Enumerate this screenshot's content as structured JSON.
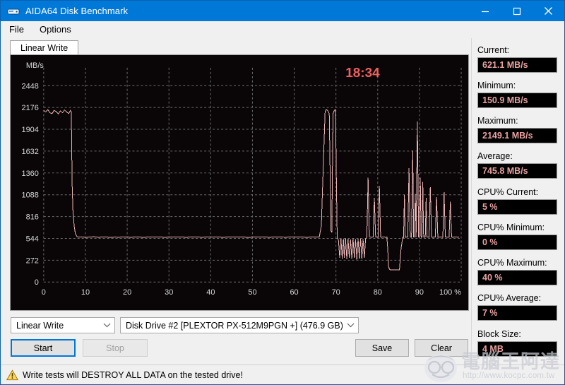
{
  "window": {
    "title": "AIDA64 Disk Benchmark",
    "icon": "disk-icon",
    "minimize_label": "–",
    "maximize_label": "□",
    "close_label": "✕"
  },
  "menu": {
    "items": [
      {
        "label": "File",
        "name": "menu-file"
      },
      {
        "label": "Options",
        "name": "menu-options"
      }
    ]
  },
  "tabs": [
    {
      "label": "Linear Write",
      "active": true
    }
  ],
  "chart_data": {
    "type": "line",
    "title": "",
    "timer": "18:34",
    "xlabel": "",
    "ylabel": "MB/s",
    "x_unit": "%",
    "xlim": [
      0,
      100
    ],
    "ylim": [
      0,
      2584
    ],
    "xticks": [
      0,
      10,
      20,
      30,
      40,
      50,
      60,
      70,
      80,
      90,
      100
    ],
    "xticklabels": [
      "0",
      "10",
      "20",
      "30",
      "40",
      "50",
      "60",
      "70",
      "80",
      "90",
      "100 %"
    ],
    "yticks": [
      0,
      272,
      544,
      816,
      1088,
      1360,
      1632,
      1904,
      2176,
      2448
    ],
    "yticklabels": [
      "0",
      "272",
      "544",
      "816",
      "1088",
      "1360",
      "1632",
      "1904",
      "2176",
      "2448"
    ],
    "grid": true,
    "grid_style": "dashed",
    "line_color": "#e9b4b4",
    "background": "#0a0608",
    "legend": null,
    "series": [
      {
        "name": "Linear Write",
        "x": [
          0.0,
          0.5,
          1.0,
          1.5,
          2.0,
          2.5,
          3.0,
          3.5,
          4.0,
          4.5,
          5.0,
          5.5,
          6.0,
          6.4,
          6.6,
          6.7,
          6.8,
          7.0,
          7.3,
          7.6,
          8.0,
          8.5,
          9.0,
          10.0,
          11.0,
          12.0,
          13.0,
          14.0,
          15.0,
          16.0,
          17.0,
          18.0,
          19.0,
          20.0,
          21.0,
          22.0,
          23.0,
          24.0,
          25.0,
          26.0,
          27.0,
          28.0,
          29.0,
          30.0,
          31.0,
          32.0,
          33.0,
          34.0,
          35.0,
          36.0,
          37.0,
          38.0,
          39.0,
          40.0,
          41.0,
          42.0,
          43.0,
          44.0,
          45.0,
          46.0,
          47.0,
          48.0,
          49.0,
          50.0,
          51.0,
          52.0,
          53.0,
          54.0,
          55.0,
          56.0,
          57.0,
          58.0,
          59.0,
          60.0,
          61.0,
          62.0,
          63.0,
          64.0,
          65.0,
          66.0,
          66.5,
          67.0,
          67.4,
          67.6,
          68.0,
          68.4,
          68.8,
          69.0,
          69.3,
          69.6,
          69.9,
          70.1,
          70.3,
          70.6,
          70.9,
          71.2,
          71.5,
          71.8,
          72.0,
          72.3,
          72.6,
          72.9,
          73.2,
          73.5,
          73.8,
          74.1,
          74.4,
          74.7,
          75.0,
          75.3,
          75.6,
          75.9,
          76.2,
          76.5,
          76.8,
          77.1,
          77.4,
          77.7,
          78.0,
          78.3,
          78.6,
          78.9,
          79.2,
          79.5,
          79.8,
          80.1,
          80.4,
          80.7,
          81.0,
          81.3,
          81.6,
          81.9,
          82.2,
          82.4,
          82.6,
          82.8,
          83.0,
          83.3,
          83.6,
          84.0,
          84.4,
          84.8,
          85.2,
          85.6,
          86.0,
          86.2,
          86.4,
          86.6,
          86.9,
          87.2,
          87.5,
          87.8,
          88.1,
          88.4,
          88.6,
          88.8,
          89.0,
          89.2,
          89.5,
          89.8,
          90.0,
          90.2,
          90.4,
          90.6,
          90.8,
          91.0,
          91.2,
          91.4,
          91.6,
          91.8,
          92.0,
          92.3,
          92.6,
          92.9,
          93.2,
          93.5,
          93.8,
          94.1,
          94.4,
          94.7,
          95.0,
          95.3,
          95.6,
          95.9,
          96.2,
          96.5,
          96.8,
          97.1,
          97.4,
          97.7,
          98.0,
          98.3,
          98.6,
          98.9,
          99.2,
          99.5,
          99.8,
          100.0
        ],
        "y": [
          2140,
          2120,
          2149,
          2110,
          2100,
          2140,
          2125,
          2095,
          2135,
          2110,
          2145,
          2120,
          2100,
          2140,
          2120,
          1780,
          1250,
          900,
          700,
          600,
          565,
          560,
          562,
          558,
          560,
          565,
          558,
          560,
          562,
          555,
          560,
          558,
          563,
          560,
          558,
          562,
          560,
          557,
          561,
          559,
          563,
          560,
          558,
          560,
          562,
          559,
          561,
          558,
          560,
          563,
          560,
          558,
          561,
          559,
          562,
          560,
          558,
          560,
          561,
          559,
          562,
          560,
          557,
          560,
          562,
          559,
          561,
          558,
          560,
          562,
          560,
          558,
          561,
          559,
          562,
          560,
          558,
          560,
          562,
          560,
          700,
          1500,
          2120,
          2149,
          2140,
          2100,
          640,
          620,
          2100,
          2140,
          2149,
          1300,
          560,
          520,
          300,
          540,
          290,
          535,
          300,
          545,
          285,
          540,
          300,
          530,
          290,
          545,
          300,
          535,
          280,
          540,
          295,
          545,
          290,
          535,
          300,
          540,
          560,
          1300,
          565,
          560,
          558,
          562,
          1050,
          560,
          562,
          558,
          1200,
          560,
          558,
          562,
          560,
          558,
          560,
          420,
          200,
          160,
          152,
          151,
          150,
          151,
          150,
          152,
          150,
          420,
          560,
          555,
          1090,
          558,
          562,
          560,
          1420,
          560,
          558,
          1640,
          562,
          560,
          1100,
          558,
          2000,
          560,
          562,
          1300,
          558,
          560,
          1250,
          562,
          558,
          560,
          1050,
          560,
          562,
          558,
          1180,
          560,
          558,
          562,
          560,
          1060,
          558,
          560,
          562,
          560,
          558,
          1120,
          560,
          562,
          558,
          560,
          1000,
          562,
          558,
          560,
          562,
          560,
          558,
          560
        ]
      }
    ]
  },
  "mode_select": {
    "value": "Linear Write",
    "name": "mode-select"
  },
  "drive_select": {
    "value": "Disk Drive #2  [PLEXTOR PX-512M9PGN +]  (476.9 GB)",
    "name": "drive-select"
  },
  "buttons": {
    "start": "Start",
    "stop": "Stop",
    "save": "Save",
    "clear": "Clear"
  },
  "stats": [
    {
      "label": "Current:",
      "value": "621.1 MB/s",
      "name": "current"
    },
    {
      "label": "Minimum:",
      "value": "150.9 MB/s",
      "name": "minimum"
    },
    {
      "label": "Maximum:",
      "value": "2149.1 MB/s",
      "name": "maximum"
    },
    {
      "label": "Average:",
      "value": "745.8 MB/s",
      "name": "average"
    }
  ],
  "cpu_stats": [
    {
      "label": "CPU% Current:",
      "value": "5 %",
      "name": "cpu-current"
    },
    {
      "label": "CPU% Minimum:",
      "value": "0 %",
      "name": "cpu-minimum"
    },
    {
      "label": "CPU% Maximum:",
      "value": "40 %",
      "name": "cpu-maximum"
    },
    {
      "label": "CPU% Average:",
      "value": "7 %",
      "name": "cpu-average"
    }
  ],
  "block_size": {
    "label": "Block Size:",
    "value": "4 MB"
  },
  "statusbar": {
    "icon": "warning-icon",
    "text": "Write tests will DESTROY ALL DATA on the tested drive!"
  },
  "watermark": {
    "brand": "電腦王阿達",
    "url": "http://www.kocpc.com.tw"
  },
  "colors": {
    "titlebar": "#0078d7",
    "chart_bg": "#0a0608",
    "chart_line": "#e9b4b4",
    "value_text": "#e8a0a0",
    "timer": "#ef5f5f"
  }
}
